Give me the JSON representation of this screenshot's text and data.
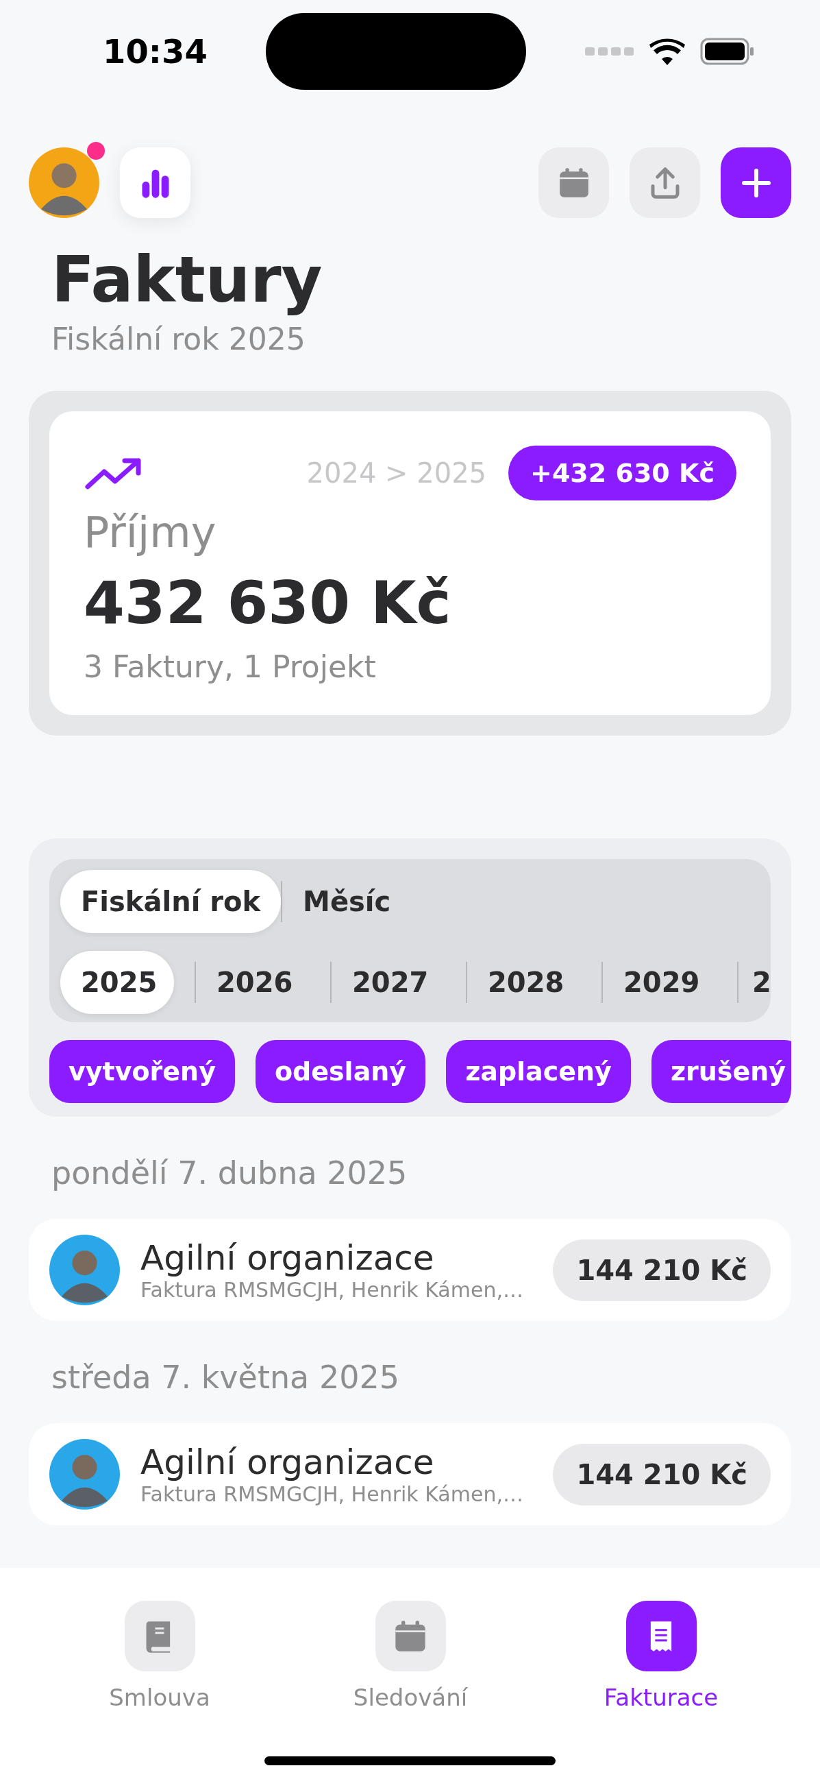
{
  "status_bar": {
    "time": "10:34"
  },
  "profile": {
    "has_notification": true
  },
  "title": "Faktury",
  "subtitle": "Fiskální rok 2025",
  "summary": {
    "period": "2024 > 2025",
    "change": "+432 630 Kč",
    "label": "Příjmy",
    "amount": "432 630 Kč",
    "details": "3 Faktury, 1 Projekt"
  },
  "period_tabs": [
    {
      "label": "Fiskální rok",
      "selected": true
    },
    {
      "label": "Měsíc",
      "selected": false
    }
  ],
  "years": [
    {
      "label": "2025",
      "selected": true
    },
    {
      "label": "2026",
      "selected": false
    },
    {
      "label": "2027",
      "selected": false
    },
    {
      "label": "2028",
      "selected": false
    },
    {
      "label": "2029",
      "selected": false
    },
    {
      "label": "2",
      "selected": false
    }
  ],
  "status_filters": [
    "vytvořený",
    "odeslaný",
    "zaplacený",
    "zrušený"
  ],
  "groups": [
    {
      "date": "pondělí 7. dubna 2025",
      "invoices": [
        {
          "client": "Agilní organizace",
          "details": "Faktura RMSMGCJH, Henrik Kámen,…",
          "amount": "144 210 Kč"
        }
      ]
    },
    {
      "date": "středa 7. května 2025",
      "invoices": [
        {
          "client": "Agilní organizace",
          "details": "Faktura RMSMGCJH, Henrik Kámen,…",
          "amount": "144 210 Kč"
        }
      ]
    }
  ],
  "tab_bar": [
    {
      "label": "Smlouva",
      "kind": "book",
      "selected": false
    },
    {
      "label": "Sledování",
      "kind": "calendar",
      "selected": false
    },
    {
      "label": "Fakturace",
      "kind": "receipt",
      "selected": true
    }
  ]
}
